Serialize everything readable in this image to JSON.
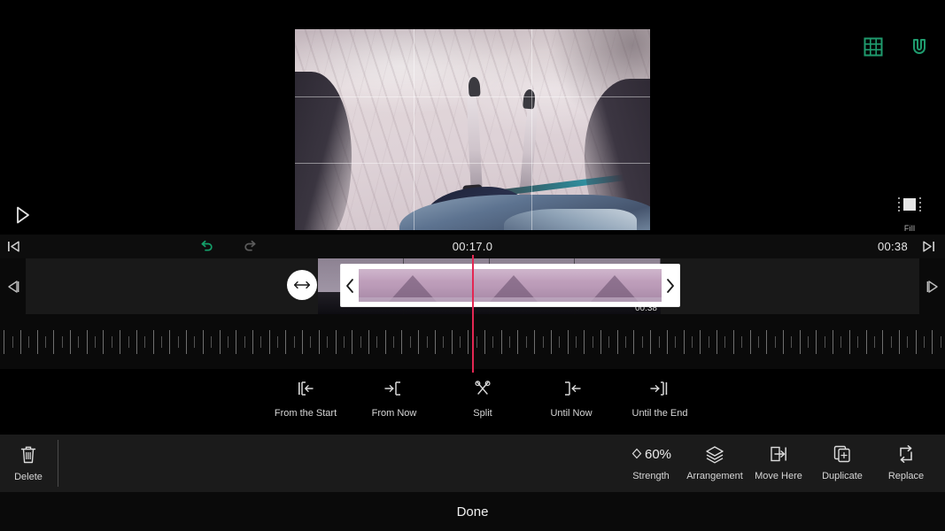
{
  "preview": {
    "grid_overlay": true,
    "grid_icon": "grid-icon",
    "magnet_icon": "magnet-icon",
    "accent_green": "#1f9b6e",
    "fill_label": "Fill",
    "play_icon": "play-icon",
    "scene": "POV skiing down a snowy slope with skis, pole and jacket visible"
  },
  "transport": {
    "skip_start_icon": "skip-to-start-icon",
    "skip_end_icon": "skip-to-end-icon",
    "undo_icon": "undo-icon",
    "redo_icon": "redo-icon",
    "undo_enabled": true,
    "redo_enabled": false,
    "current_time": "00:17.0",
    "total_time": "00:38"
  },
  "timeline": {
    "step_back_icon": "step-back-icon",
    "step_forward_icon": "step-forward-icon",
    "drag_handle_icon": "horizontal-resize-icon",
    "clip_prev_icon": "chevron-left-icon",
    "clip_next_icon": "chevron-right-icon",
    "clip_end_time": "00:38",
    "playhead_color": "#e32753",
    "clip_color": "#bb9bb8"
  },
  "trim_actions": [
    {
      "label": "From the Start",
      "icon": "trim-from-start-icon"
    },
    {
      "label": "From Now",
      "icon": "trim-from-now-icon"
    },
    {
      "label": "Split",
      "icon": "scissors-icon"
    },
    {
      "label": "Until Now",
      "icon": "trim-until-now-icon"
    },
    {
      "label": "Until the End",
      "icon": "trim-until-end-icon"
    }
  ],
  "toolbar": {
    "delete": {
      "label": "Delete",
      "icon": "trash-icon"
    },
    "items": [
      {
        "label": "Strength",
        "icon": "diamond-icon",
        "value": "60%"
      },
      {
        "label": "Arrangement",
        "icon": "layers-icon"
      },
      {
        "label": "Move Here",
        "icon": "move-here-icon"
      },
      {
        "label": "Duplicate",
        "icon": "duplicate-icon"
      },
      {
        "label": "Replace",
        "icon": "replace-icon"
      }
    ]
  },
  "done": {
    "label": "Done"
  }
}
